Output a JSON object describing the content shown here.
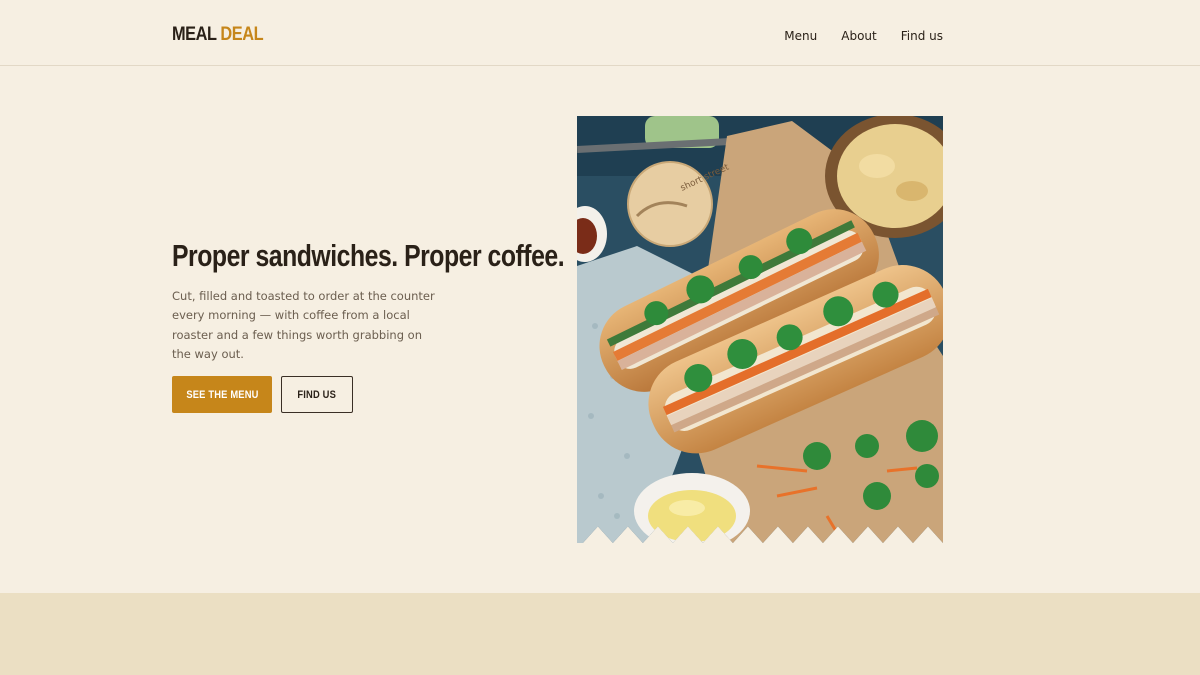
{
  "header": {
    "logo_main": "MEAL",
    "logo_accent": "DEAL",
    "nav": [
      "Menu",
      "About",
      "Find us"
    ]
  },
  "hero": {
    "title": "Proper sandwiches. Proper coffee.",
    "body": "Cut, filled and toasted to order at the counter every morning — with coffee from a local roaster and a few things worth grabbing on the way out.",
    "primary_cta": "SEE THE MENU",
    "secondary_cta": "FIND US",
    "image_subject": "banh-mi-sandwiches-photo",
    "cup_lid_text": "short street"
  },
  "colors": {
    "background": "#f6efe2",
    "accent": "#c6861a",
    "text": "#2a2118",
    "muted": "#6b5e4f",
    "footer_band": "#ebdfc3"
  }
}
